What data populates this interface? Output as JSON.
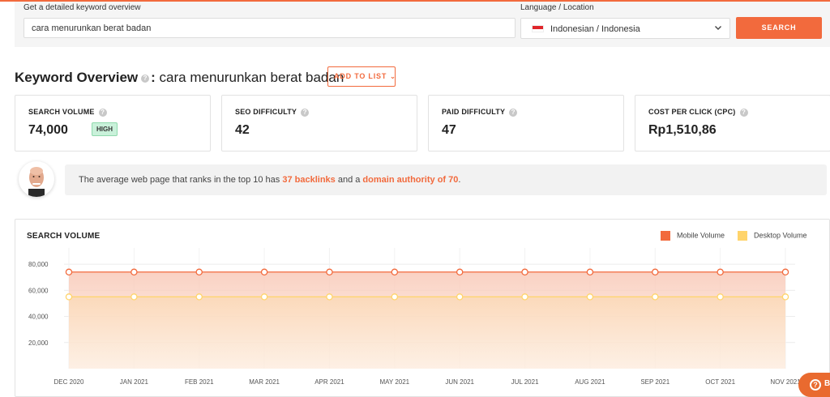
{
  "search": {
    "label": "Get a detailed keyword overview",
    "query": "cara menurunkan berat badan",
    "location_label": "Language / Location",
    "location_value": "Indonesian / Indonesia",
    "button": "SEARCH"
  },
  "overview": {
    "title": "Keyword Overview",
    "separator": ":",
    "keyword": "cara menurunkan berat badan",
    "add_to_list": "ADD TO LIST"
  },
  "metrics": [
    {
      "title": "SEARCH VOLUME",
      "value": "74,000",
      "badge": "HIGH"
    },
    {
      "title": "SEO DIFFICULTY",
      "value": "42"
    },
    {
      "title": "PAID DIFFICULTY",
      "value": "47"
    },
    {
      "title": "COST PER CLICK (CPC)",
      "value": "Rp1,510,86"
    }
  ],
  "tip": {
    "prefix": "The average web page that ranks in the top 10 has ",
    "backlinks": "37 backlinks",
    "middle": " and a ",
    "authority": "domain authority of 70",
    "suffix": "."
  },
  "chart": {
    "title": "SEARCH VOLUME",
    "legend_mobile": "Mobile Volume",
    "legend_desktop": "Desktop Volume"
  },
  "colors": {
    "accent": "#f26a3d",
    "mobile": "#f26a3d",
    "desktop": "#ffd46b"
  },
  "help_button": {
    "icon": "help-circle-icon",
    "label": "B"
  },
  "chart_data": {
    "type": "area",
    "categories": [
      "DEC 2020",
      "JAN 2021",
      "FEB 2021",
      "MAR 2021",
      "APR 2021",
      "MAY 2021",
      "JUN 2021",
      "JUL 2021",
      "AUG 2021",
      "SEP 2021",
      "OCT 2021",
      "NOV 2021"
    ],
    "yticks": [
      "20,000",
      "40,000",
      "60,000",
      "80,000"
    ],
    "ylim": [
      0,
      90000
    ],
    "series": [
      {
        "name": "Mobile Volume",
        "values": [
          74000,
          74000,
          74000,
          74000,
          74000,
          74000,
          74000,
          74000,
          74000,
          74000,
          74000,
          74000
        ]
      },
      {
        "name": "Desktop Volume",
        "values": [
          55000,
          55000,
          55000,
          55000,
          55000,
          55000,
          55000,
          55000,
          55000,
          55000,
          55000,
          55000
        ]
      }
    ],
    "grid": true,
    "legend": "top-right"
  }
}
